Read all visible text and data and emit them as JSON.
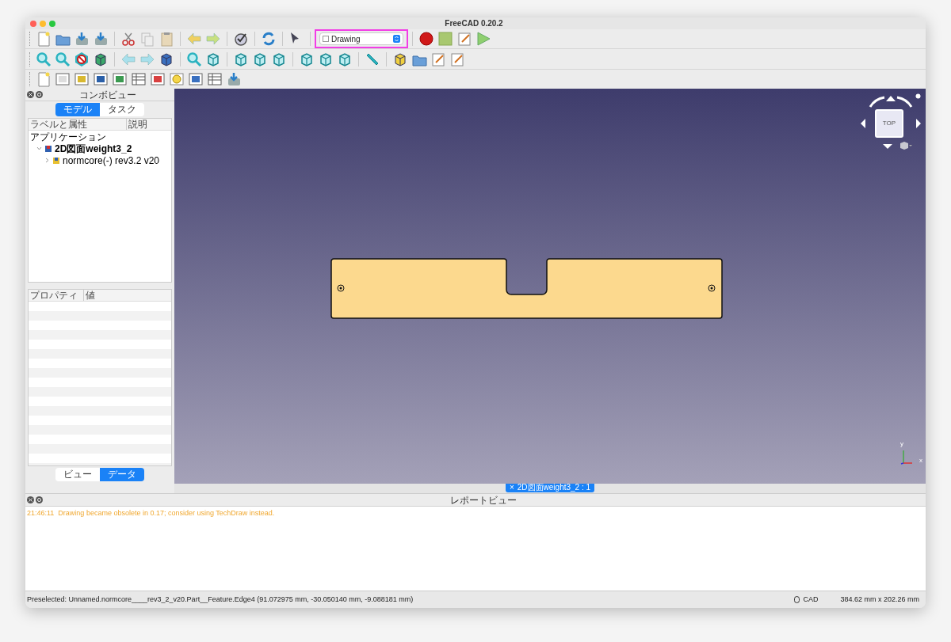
{
  "window": {
    "title": "FreeCAD 0.20.2"
  },
  "workbench": {
    "value": "Drawing",
    "highlighted": true
  },
  "combo_view": {
    "title": "コンボビュー",
    "tabs": [
      {
        "label": "モデル",
        "selected": true
      },
      {
        "label": "タスク",
        "selected": false
      }
    ],
    "tree_columns": [
      "ラベルと属性",
      "説明"
    ],
    "tree": [
      {
        "label": "アプリケーション",
        "children": [
          {
            "label": "2D図面weight3_2",
            "expanded": true,
            "children": [
              {
                "label": "normcore(-) rev3.2 v20",
                "expanded": false
              }
            ]
          }
        ]
      }
    ],
    "property_columns": [
      "プロパティ",
      "値"
    ],
    "bottom_tabs": [
      {
        "label": "ビュー",
        "selected": false
      },
      {
        "label": "データ",
        "selected": true
      }
    ]
  },
  "viewport": {
    "nav_cube_face": "TOP",
    "axes": [
      "y",
      "x"
    ],
    "document_tab": "2D図面weight3_2 : 1",
    "document_tab_close": "×"
  },
  "report_view": {
    "title": "レポートビュー",
    "messages": [
      {
        "text": "21:46:11  Drawing became obsolete in 0.17; consider using TechDraw instead.",
        "color": "#f0a830"
      }
    ]
  },
  "status_bar": {
    "message": "Preselected: Unnamed.normcore____rev3_2_v20.Part__Feature.Edge4 (91.072975 mm, -30.050140 mm, -9.088181 mm)",
    "nav_style": "CAD",
    "dimensions": "384.62 mm x 202.26 mm"
  }
}
